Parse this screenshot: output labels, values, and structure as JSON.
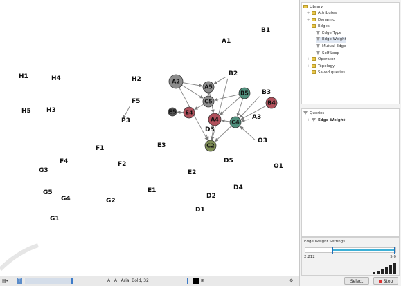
{
  "nodes_plain": [
    {
      "id": "A1"
    },
    {
      "id": "B1"
    },
    {
      "id": "H1"
    },
    {
      "id": "H4"
    },
    {
      "id": "H2"
    },
    {
      "id": "B2"
    },
    {
      "id": "B3"
    },
    {
      "id": "H5"
    },
    {
      "id": "H3"
    },
    {
      "id": "F5"
    },
    {
      "id": "P3"
    },
    {
      "id": "D3"
    },
    {
      "id": "A3"
    },
    {
      "id": "O3"
    },
    {
      "id": "E3"
    },
    {
      "id": "F1"
    },
    {
      "id": "F4"
    },
    {
      "id": "F2"
    },
    {
      "id": "G3"
    },
    {
      "id": "D5"
    },
    {
      "id": "O1"
    },
    {
      "id": "E2"
    },
    {
      "id": "D4"
    },
    {
      "id": "G5"
    },
    {
      "id": "G4"
    },
    {
      "id": "E1"
    },
    {
      "id": "D2"
    },
    {
      "id": "G2"
    },
    {
      "id": "D1"
    },
    {
      "id": "G1"
    }
  ],
  "nodes_circle": [
    {
      "id": "A2",
      "color": "#8c8c8c"
    },
    {
      "id": "A5",
      "color": "#8c8c8c"
    },
    {
      "id": "C5",
      "color": "#8c8c8c"
    },
    {
      "id": "B5",
      "color": "#4f8f7c"
    },
    {
      "id": "B4",
      "color": "#b0505b"
    },
    {
      "id": "E5",
      "color": "#555555"
    },
    {
      "id": "E4",
      "color": "#b0505b"
    },
    {
      "id": "A4",
      "color": "#b0505b"
    },
    {
      "id": "C4",
      "color": "#4f8f7c"
    },
    {
      "id": "C2",
      "color": "#7d8c55"
    }
  ],
  "edges": [
    [
      "A2",
      "A5"
    ],
    [
      "A2",
      "C5"
    ],
    [
      "A2",
      "C2"
    ],
    [
      "A5",
      "C5"
    ],
    [
      "C5",
      "E4"
    ],
    [
      "E4",
      "E5"
    ],
    [
      "B5",
      "C5"
    ],
    [
      "B5",
      "A4"
    ],
    [
      "B5",
      "C4"
    ],
    [
      "B2",
      "C2"
    ],
    [
      "B2",
      "A5"
    ],
    [
      "B3",
      "C4"
    ],
    [
      "B4",
      "C4"
    ],
    [
      "A3",
      "C4"
    ],
    [
      "C4",
      "A4"
    ],
    [
      "C4",
      "C2"
    ],
    [
      "A4",
      "C2"
    ],
    [
      "O3",
      "C4"
    ],
    [
      "D3",
      "C2"
    ],
    [
      "F5",
      "P3"
    ],
    [
      "A5",
      "A4"
    ]
  ],
  "library": {
    "title": "Library",
    "items": [
      {
        "label": "Attributes",
        "kind": "folder",
        "pm": "+"
      },
      {
        "label": "Dynamic",
        "kind": "folder",
        "pm": "+"
      },
      {
        "label": "Edges",
        "kind": "folder",
        "pm": "−"
      },
      {
        "label": "Edge Type",
        "kind": "filter",
        "pm": ""
      },
      {
        "label": "Edge Weight",
        "kind": "filter",
        "pm": "",
        "selected": true
      },
      {
        "label": "Mutual Edge",
        "kind": "filter",
        "pm": ""
      },
      {
        "label": "Self Loop",
        "kind": "filter",
        "pm": ""
      },
      {
        "label": "Operator",
        "kind": "folder",
        "pm": "+"
      },
      {
        "label": "Topology",
        "kind": "folder",
        "pm": "+"
      },
      {
        "label": "Saved queries",
        "kind": "folder",
        "pm": ""
      }
    ]
  },
  "queries": {
    "title": "Queries",
    "item": "Edge Weight"
  },
  "settings": {
    "title": "Edge Weight Settings",
    "min_label": "2.212",
    "max_label": "5.0",
    "range_low_fraction": 0.3,
    "range_high_fraction": 1.0,
    "accent": "#3db0d6"
  },
  "buttons": {
    "select": "Select",
    "stop": "Stop"
  },
  "toolbar": {
    "font_label": "A · A · Arial Bold, 32"
  }
}
